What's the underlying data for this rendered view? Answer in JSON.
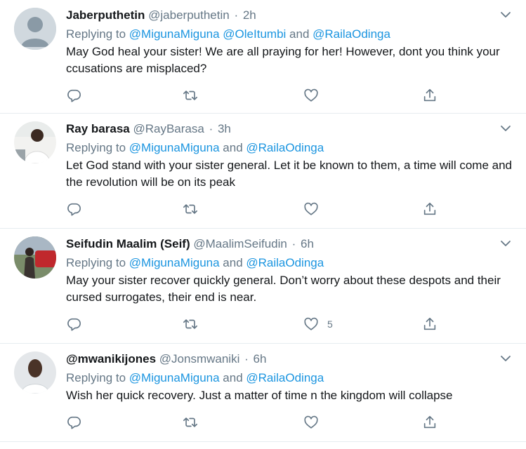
{
  "colors": {
    "link": "#1b95e0",
    "muted": "#657786",
    "text": "#14171a",
    "divider": "#e6ecf0"
  },
  "tweets": [
    {
      "name": "Jaberputhetin",
      "handle": "@jaberputhetin",
      "dot": "·",
      "time": "2h",
      "replying_prefix": "Replying to ",
      "mention1": "@MigunaMiguna",
      "sep1": " ",
      "mention2": "@OleItumbi",
      "sep2": " and ",
      "mention3": "@RailaOdinga",
      "text": "May God heal your sister! We are all praying for her! However, dont you think your ccusations are misplaced?",
      "likes": "",
      "avatar_icon": "default-avatar-icon"
    },
    {
      "name": "Ray barasa",
      "handle": "@RayBarasa",
      "dot": "·",
      "time": "3h",
      "replying_prefix": "Replying to ",
      "mention1": "@MigunaMiguna",
      "sep1": " and ",
      "mention2": "@RailaOdinga",
      "text": "Let God stand with your sister general. Let it be known to them, a time will come and the revolution will be on its peak",
      "likes": "",
      "avatar_icon": "profile-photo"
    },
    {
      "name": "Seifudin Maalim (Seif)",
      "handle": "@MaalimSeifudin",
      "dot": "·",
      "time": "6h",
      "replying_prefix": "Replying to ",
      "mention1": "@MigunaMiguna",
      "sep1": " and ",
      "mention2": "@RailaOdinga",
      "text": "May your sister recover quickly general. Don’t worry about these despots and their cursed surrogates, their end is near.",
      "likes": "5",
      "avatar_icon": "profile-photo"
    },
    {
      "name": "@mwanikijones",
      "handle": "@Jonsmwaniki",
      "dot": "·",
      "time": "6h",
      "replying_prefix": "Replying to ",
      "mention1": "@MigunaMiguna",
      "sep1": " and ",
      "mention2": "@RailaOdinga",
      "text": "Wish her quick recovery.  Just a matter of time n the kingdom will collapse",
      "likes": "",
      "avatar_icon": "profile-photo"
    }
  ]
}
